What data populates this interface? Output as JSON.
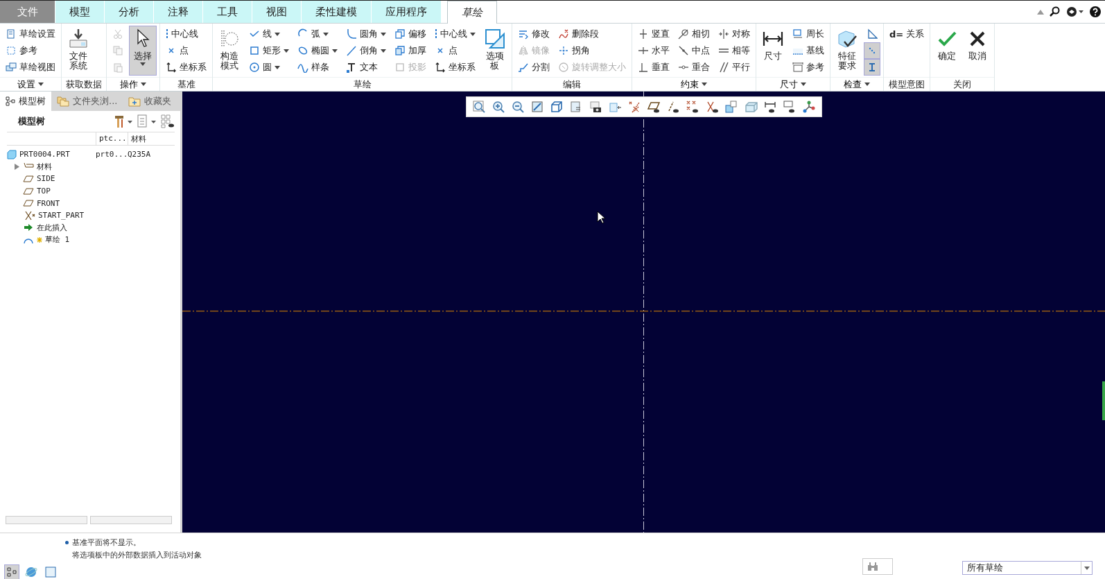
{
  "tabs": [
    {
      "label": "文件",
      "kind": "file",
      "selected": false
    },
    {
      "label": "模型",
      "kind": "tab",
      "selected": false
    },
    {
      "label": "分析",
      "kind": "tab",
      "selected": false
    },
    {
      "label": "注释",
      "kind": "tab",
      "selected": false
    },
    {
      "label": "工具",
      "kind": "tab",
      "selected": false
    },
    {
      "label": "视图",
      "kind": "tab",
      "selected": false
    },
    {
      "label": "柔性建模",
      "kind": "tab",
      "selected": false
    },
    {
      "label": "应用程序",
      "kind": "tab",
      "selected": false
    },
    {
      "label": "草绘",
      "kind": "tab",
      "selected": true
    }
  ],
  "ribbon": {
    "groups": [
      {
        "label": "设置",
        "menu": true,
        "columns": [
          {
            "tools": [
              {
                "kind": "small",
                "label": "草绘设置",
                "disabled": false,
                "dropdown": false
              },
              {
                "kind": "small",
                "label": "参考",
                "disabled": false,
                "dropdown": false
              },
              {
                "kind": "small",
                "label": "草绘视图",
                "disabled": false,
                "dropdown": false
              }
            ]
          }
        ]
      },
      {
        "label": "获取数据",
        "menu": false,
        "columns": [
          {
            "tools": [
              {
                "kind": "large",
                "label": "文件系统",
                "disabled": false,
                "dropdown": false,
                "selected": false
              }
            ]
          }
        ]
      },
      {
        "label": "操作",
        "menu": true,
        "columns": [
          {
            "tools": [
              {
                "kind": "icon",
                "disabled": true,
                "selected": false
              },
              {
                "kind": "icon",
                "disabled": true,
                "selected": false
              },
              {
                "kind": "icon",
                "disabled": true,
                "selected": false
              }
            ]
          },
          {
            "tools": [
              {
                "kind": "large",
                "label": "选择",
                "disabled": false,
                "dropdown": true,
                "selected": true
              }
            ]
          }
        ]
      },
      {
        "label": "基准",
        "menu": false,
        "columns": [
          {
            "tools": [
              {
                "kind": "small",
                "label": "中心线",
                "disabled": false,
                "dropdown": false
              },
              {
                "kind": "small",
                "label": "点",
                "disabled": false,
                "dropdown": false
              },
              {
                "kind": "small",
                "label": "坐标系",
                "disabled": false,
                "dropdown": false
              }
            ]
          }
        ]
      },
      {
        "label": "草绘",
        "menu": false,
        "columns": [
          {
            "tools": [
              {
                "kind": "large",
                "label": "构造模式",
                "disabled": false,
                "dropdown": false,
                "selected": false
              }
            ]
          },
          {
            "tools": [
              {
                "kind": "small",
                "label": "线",
                "disabled": false,
                "dropdown": true
              },
              {
                "kind": "small",
                "label": "矩形",
                "disabled": false,
                "dropdown": true
              },
              {
                "kind": "small",
                "label": "圆",
                "disabled": false,
                "dropdown": true
              }
            ]
          },
          {
            "tools": [
              {
                "kind": "small",
                "label": "弧",
                "disabled": false,
                "dropdown": true
              },
              {
                "kind": "small",
                "label": "椭圆",
                "disabled": false,
                "dropdown": true
              },
              {
                "kind": "small",
                "label": "样条",
                "disabled": false,
                "dropdown": false
              }
            ]
          },
          {
            "tools": [
              {
                "kind": "small",
                "label": "圆角",
                "disabled": false,
                "dropdown": true
              },
              {
                "kind": "small",
                "label": "倒角",
                "disabled": false,
                "dropdown": true
              },
              {
                "kind": "small",
                "label": "文本",
                "disabled": false,
                "dropdown": false
              }
            ]
          },
          {
            "tools": [
              {
                "kind": "small",
                "label": "偏移",
                "disabled": false,
                "dropdown": false
              },
              {
                "kind": "small",
                "label": "加厚",
                "disabled": false,
                "dropdown": false
              },
              {
                "kind": "small",
                "label": "投影",
                "disabled": true,
                "dropdown": false
              }
            ]
          },
          {
            "tools": [
              {
                "kind": "small",
                "label": "中心线",
                "disabled": false,
                "dropdown": true
              },
              {
                "kind": "small",
                "label": "点",
                "disabled": false,
                "dropdown": false
              },
              {
                "kind": "small",
                "label": "坐标系",
                "disabled": false,
                "dropdown": false
              }
            ]
          },
          {
            "tools": [
              {
                "kind": "large",
                "label": "选项板",
                "disabled": false,
                "dropdown": false,
                "selected": false
              }
            ]
          }
        ]
      },
      {
        "label": "编辑",
        "menu": false,
        "columns": [
          {
            "tools": [
              {
                "kind": "small",
                "label": "修改",
                "disabled": false,
                "dropdown": false
              },
              {
                "kind": "small",
                "label": "镜像",
                "disabled": true,
                "dropdown": false
              },
              {
                "kind": "small",
                "label": "分割",
                "disabled": false,
                "dropdown": false
              }
            ]
          },
          {
            "tools": [
              {
                "kind": "small",
                "label": "删除段",
                "disabled": false,
                "dropdown": false
              },
              {
                "kind": "small",
                "label": "拐角",
                "disabled": false,
                "dropdown": false
              },
              {
                "kind": "small",
                "label": "旋转调整大小",
                "disabled": true,
                "dropdown": false
              }
            ]
          }
        ]
      },
      {
        "label": "约束",
        "menu": true,
        "columns": [
          {
            "tools": [
              {
                "kind": "small",
                "label": "竖直",
                "disabled": false,
                "dropdown": false
              },
              {
                "kind": "small",
                "label": "水平",
                "disabled": false,
                "dropdown": false
              },
              {
                "kind": "small",
                "label": "垂直",
                "disabled": false,
                "dropdown": false
              }
            ]
          },
          {
            "tools": [
              {
                "kind": "small",
                "label": "相切",
                "disabled": false,
                "dropdown": false
              },
              {
                "kind": "small",
                "label": "中点",
                "disabled": false,
                "dropdown": false
              },
              {
                "kind": "small",
                "label": "重合",
                "disabled": false,
                "dropdown": false
              }
            ]
          },
          {
            "tools": [
              {
                "kind": "small",
                "label": "对称",
                "disabled": false,
                "dropdown": false
              },
              {
                "kind": "small",
                "label": "相等",
                "disabled": false,
                "dropdown": false
              },
              {
                "kind": "small",
                "label": "平行",
                "disabled": false,
                "dropdown": false
              }
            ]
          }
        ]
      },
      {
        "label": "尺寸",
        "menu": true,
        "columns": [
          {
            "tools": [
              {
                "kind": "large",
                "label": "尺寸",
                "disabled": false,
                "dropdown": false,
                "selected": false
              }
            ]
          },
          {
            "tools": [
              {
                "kind": "small",
                "label": "周长",
                "disabled": false,
                "dropdown": false
              },
              {
                "kind": "small",
                "label": "基线",
                "disabled": false,
                "dropdown": false
              },
              {
                "kind": "small",
                "label": "参考",
                "disabled": false,
                "dropdown": false
              }
            ]
          }
        ]
      },
      {
        "label": "检查",
        "menu": true,
        "columns": [
          {
            "tools": [
              {
                "kind": "large",
                "label": "特征要求",
                "disabled": false,
                "dropdown": false,
                "selected": false
              }
            ]
          },
          {
            "tools": [
              {
                "kind": "icon",
                "disabled": false,
                "selected": false
              },
              {
                "kind": "icon",
                "disabled": false,
                "selected": true
              },
              {
                "kind": "icon",
                "disabled": false,
                "selected": true
              }
            ]
          }
        ]
      },
      {
        "label": "模型意图",
        "menu": false,
        "columns": [
          {
            "tools": [
              {
                "kind": "glyph",
                "glyph": "d=",
                "label": "关系",
                "disabled": false,
                "dropdown": false
              }
            ]
          }
        ]
      },
      {
        "label": "关闭",
        "menu": false,
        "columns": [
          {
            "tools": [
              {
                "kind": "large",
                "label": "确定",
                "disabled": false,
                "dropdown": false,
                "selected": false
              }
            ]
          },
          {
            "tools": [
              {
                "kind": "large",
                "label": "取消",
                "disabled": false,
                "dropdown": false,
                "selected": false
              }
            ]
          }
        ]
      }
    ]
  },
  "panel": {
    "tabs": [
      {
        "label": "模型树",
        "selected": true
      },
      {
        "label": "文件夹浏...",
        "selected": false
      },
      {
        "label": "收藏夹",
        "selected": false
      }
    ],
    "title": "模型树",
    "columns": [
      "ptc...",
      "材料"
    ],
    "tree": [
      {
        "name": "PRT0004.PRT",
        "cells": [
          "prt0...",
          "Q235A"
        ],
        "children": [
          {
            "name": "材料",
            "expanded": false
          },
          {
            "name": "SIDE"
          },
          {
            "name": "TOP"
          },
          {
            "name": "FRONT"
          },
          {
            "name": "START_PART"
          },
          {
            "name": "在此插入"
          },
          {
            "name": "草绘 1"
          }
        ]
      }
    ]
  },
  "status_bar": {
    "messages": [
      {
        "text": "基准平面将不显示。",
        "bullet": true
      },
      {
        "text": "将选项板中的外部数据插入到活动对象",
        "bullet": false
      }
    ],
    "tools": [
      {
        "selected": true
      },
      {
        "selected": false
      },
      {
        "selected": false
      }
    ],
    "filter": {
      "value": "所有草绘"
    }
  }
}
